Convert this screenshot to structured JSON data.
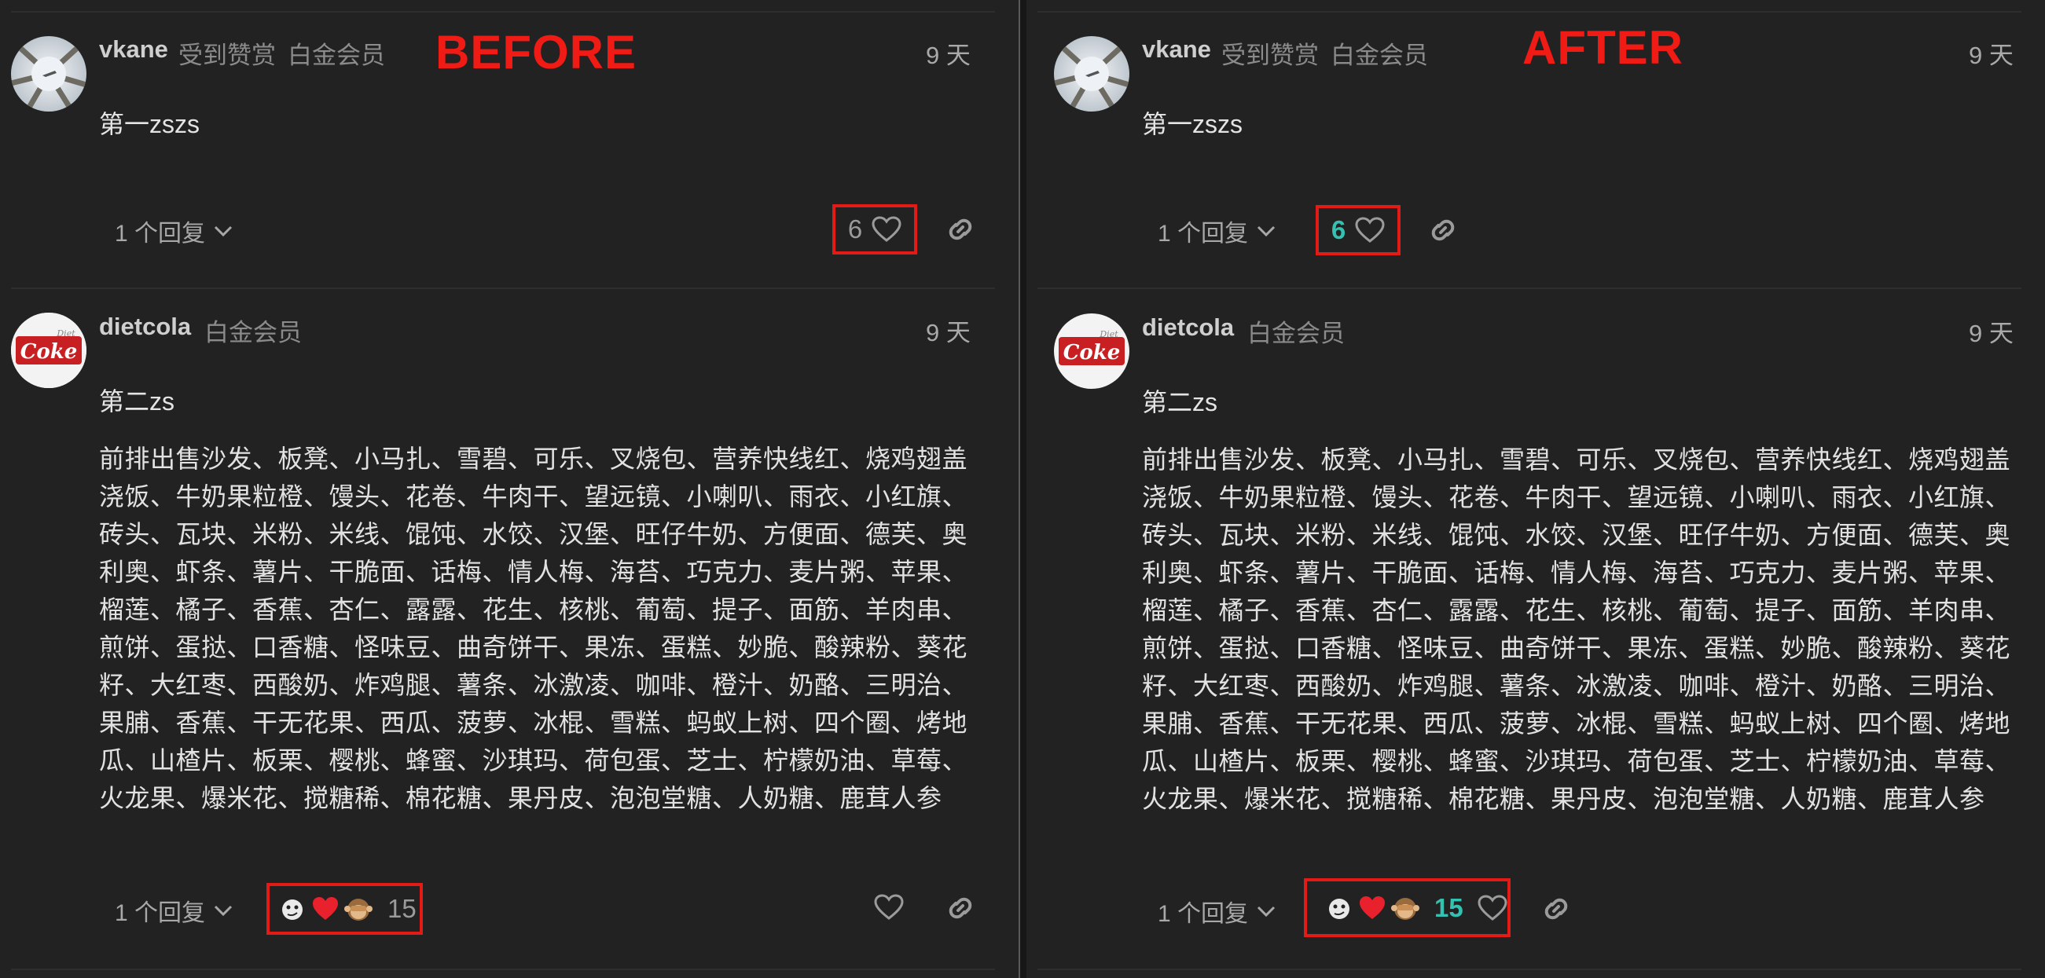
{
  "before": {
    "label": "BEFORE",
    "post1": {
      "username": "vkane",
      "flair1": "受到赞赏",
      "flair2": "白金会员",
      "time": "9 天",
      "content": "第一zszs",
      "replies": "1 个回复",
      "like_count": "6"
    },
    "post2": {
      "username": "dietcola",
      "flair1": "白金会员",
      "time": "9 天",
      "title_line": "第二zs",
      "paragraph": "前排出售沙发、板凳、小马扎、雪碧、可乐、叉烧包、营养快线红、烧鸡翅盖浇饭、牛奶果粒橙、馒头、花卷、牛肉干、望远镜、小喇叭、雨衣、小红旗、砖头、瓦块、米粉、米线、馄饨、水饺、汉堡、旺仔牛奶、方便面、德芙、奥利奥、虾条、薯片、干脆面、话梅、情人梅、海苔、巧克力、麦片粥、苹果、榴莲、橘子、香蕉、杏仁、露露、花生、核桃、葡萄、提子、面筋、羊肉串、煎饼、蛋挞、口香糖、怪味豆、曲奇饼干、果冻、蛋糕、妙脆、酸辣粉、葵花籽、大红枣、西酸奶、炸鸡腿、薯条、冰激凌、咖啡、橙汁、奶酪、三明治、果脯、香蕉、干无花果、西瓜、菠萝、冰棍、雪糕、蚂蚁上树、四个圈、烤地瓜、山楂片、板栗、樱桃、蜂蜜、沙琪玛、荷包蛋、芝士、柠檬奶油、草莓、火龙果、爆米花、搅糖稀、棉花糖、果丹皮、泡泡堂糖、人奶糖、鹿茸人参",
      "replies": "1 个回复",
      "reaction_count": "15"
    }
  },
  "after": {
    "label": "AFTER",
    "post1": {
      "username": "vkane",
      "flair1": "受到赞赏",
      "flair2": "白金会员",
      "time": "9 天",
      "content": "第一zszs",
      "replies": "1 个回复",
      "like_count": "6"
    },
    "post2": {
      "username": "dietcola",
      "flair1": "白金会员",
      "time": "9 天",
      "title_line": "第二zs",
      "paragraph": "前排出售沙发、板凳、小马扎、雪碧、可乐、叉烧包、营养快线红、烧鸡翅盖浇饭、牛奶果粒橙、馒头、花卷、牛肉干、望远镜、小喇叭、雨衣、小红旗、砖头、瓦块、米粉、米线、馄饨、水饺、汉堡、旺仔牛奶、方便面、德芙、奥利奥、虾条、薯片、干脆面、话梅、情人梅、海苔、巧克力、麦片粥、苹果、榴莲、橘子、香蕉、杏仁、露露、花生、核桃、葡萄、提子、面筋、羊肉串、煎饼、蛋挞、口香糖、怪味豆、曲奇饼干、果冻、蛋糕、妙脆、酸辣粉、葵花籽、大红枣、西酸奶、炸鸡腿、薯条、冰激凌、咖啡、橙汁、奶酪、三明治、果脯、香蕉、干无花果、西瓜、菠萝、冰棍、雪糕、蚂蚁上树、四个圈、烤地瓜、山楂片、板栗、樱桃、蜂蜜、沙琪玛、荷包蛋、芝士、柠檬奶油、草莓、火龙果、爆米花、搅糖稀、棉花糖、果丹皮、泡泡堂糖、人奶糖、鹿茸人参",
      "replies": "1 个回复",
      "reaction_count": "15"
    }
  },
  "avatar_logo_text": "Coke",
  "avatar_logo_small": "Diet",
  "icons": [
    "heart-icon",
    "link-icon",
    "chevron-down-icon",
    "emoji-reaction-icons"
  ],
  "colors": {
    "background": "#222222",
    "accent_teal": "#35c1b2",
    "annotation_red": "#e31b17"
  }
}
